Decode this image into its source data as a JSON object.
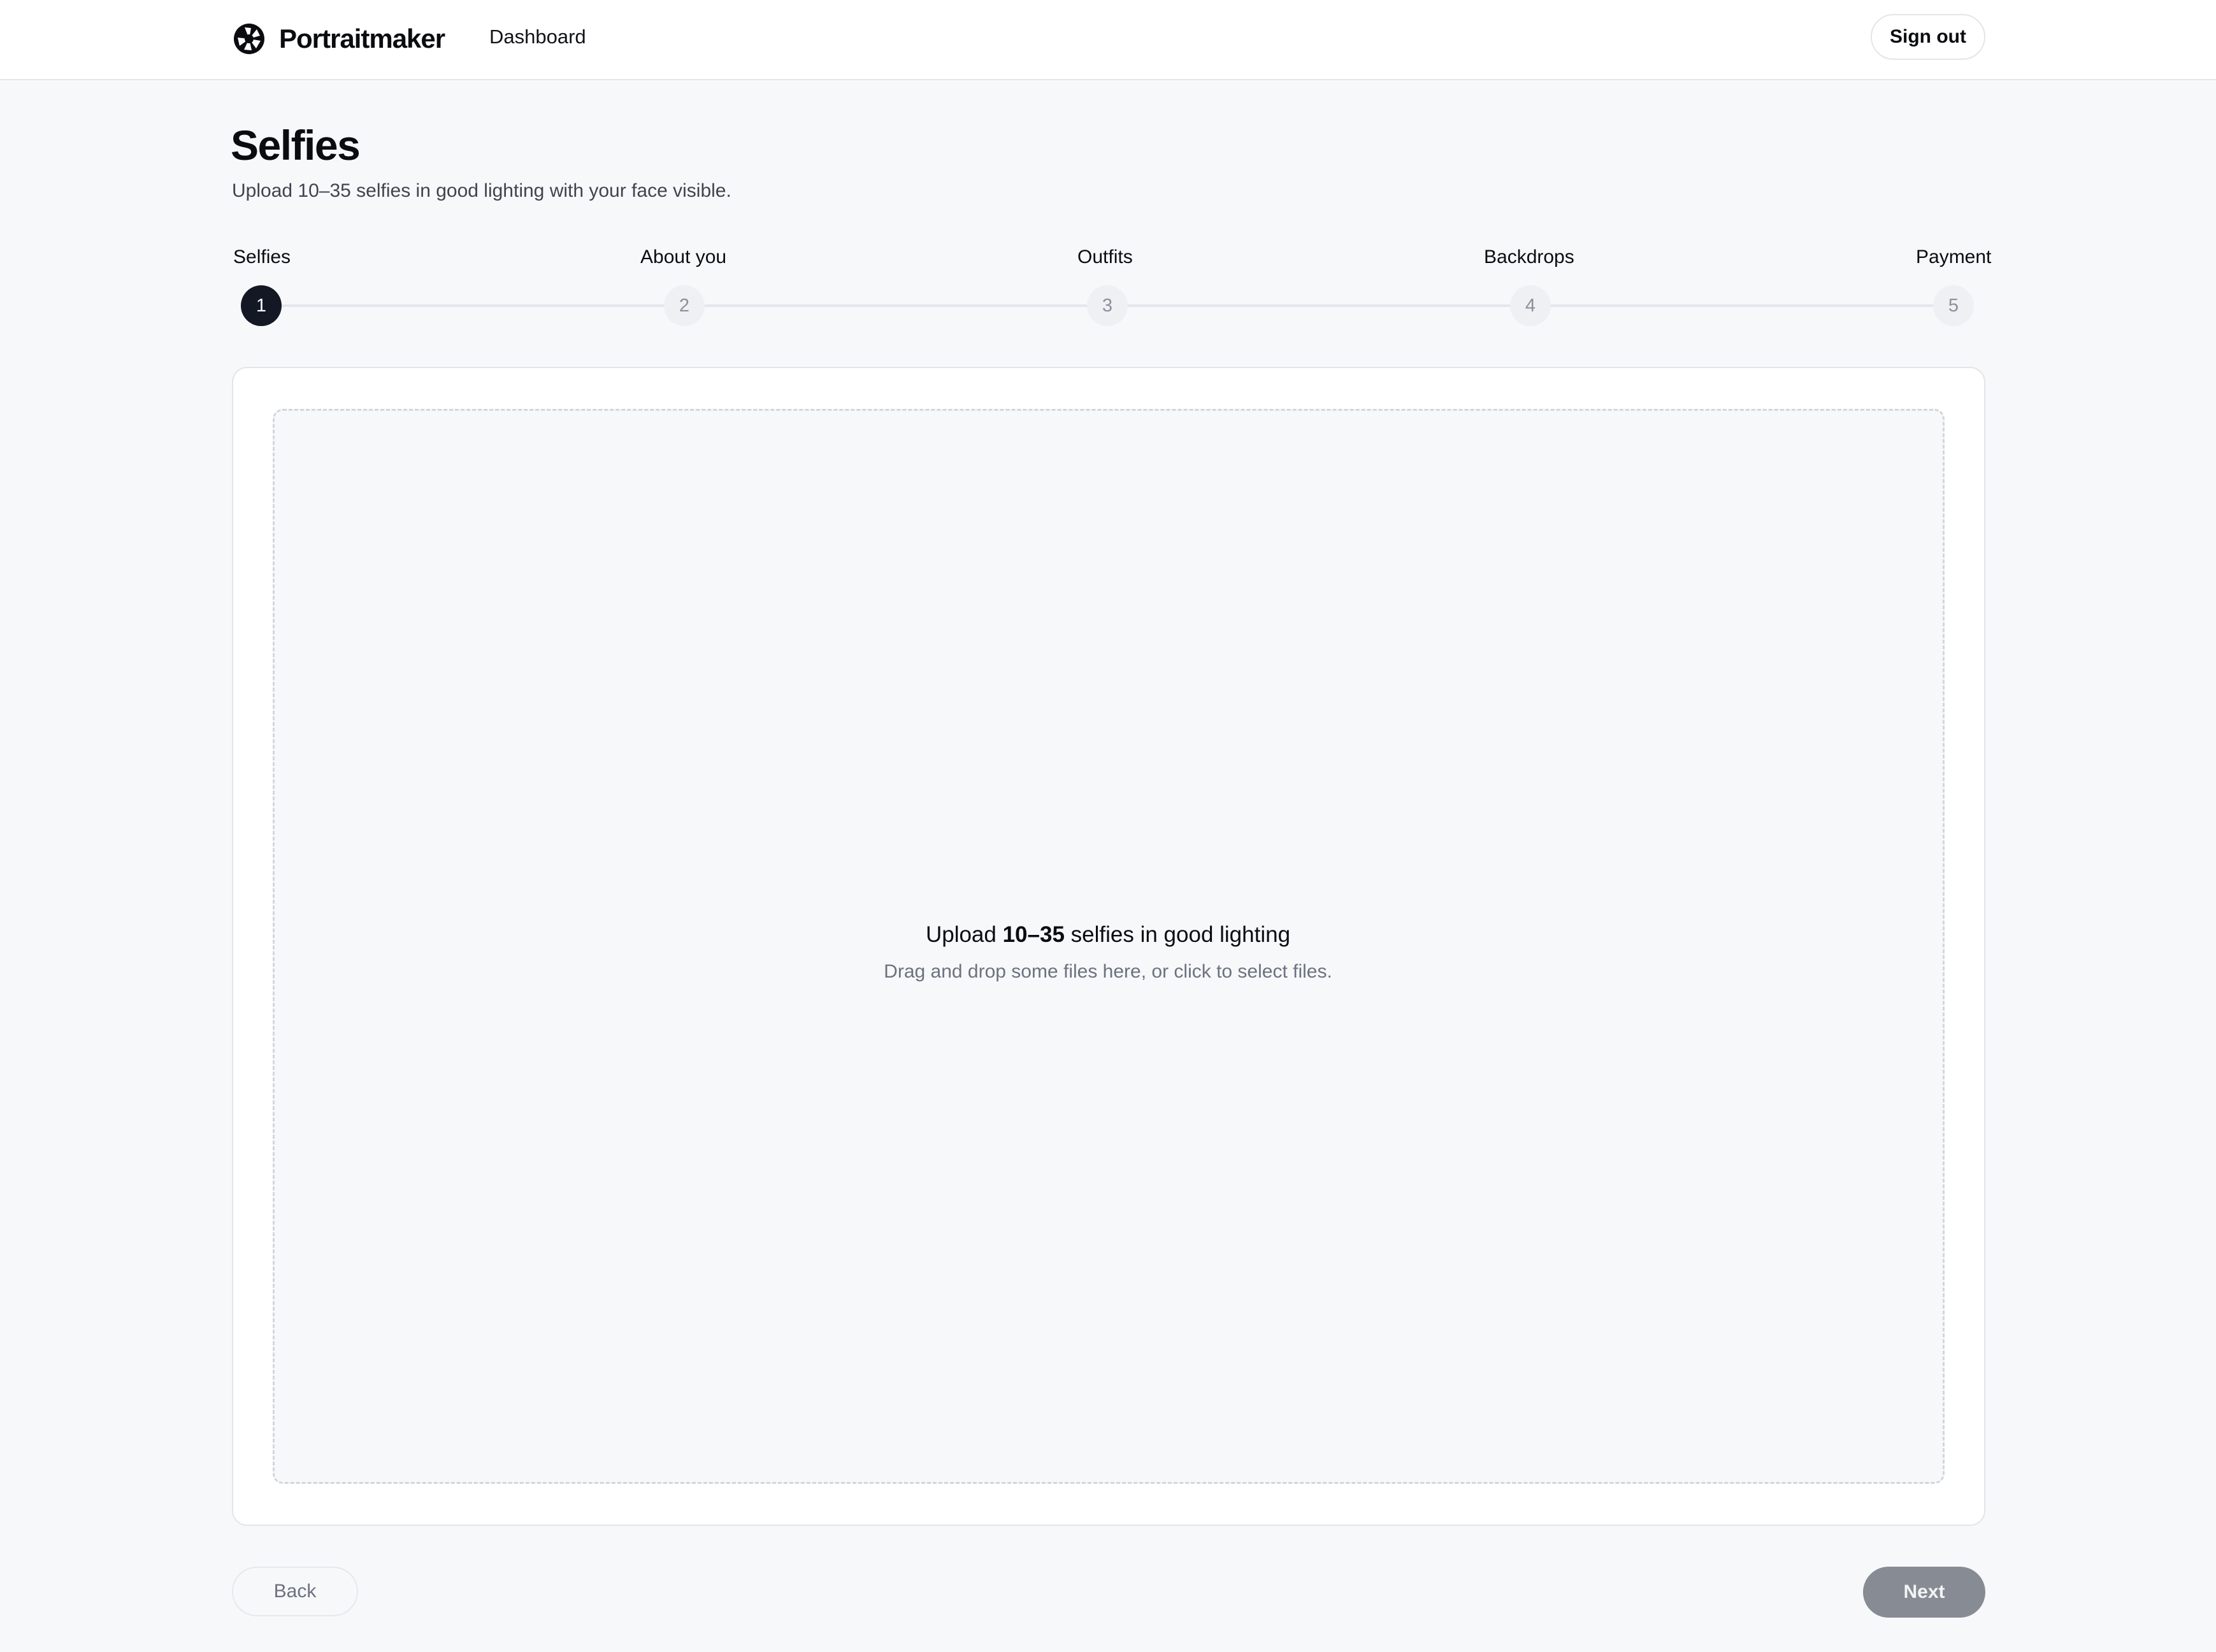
{
  "header": {
    "brand_name": "Portraitmaker",
    "logo_icon": "aperture-icon",
    "nav": [
      {
        "label": "Dashboard"
      }
    ],
    "sign_out_label": "Sign out"
  },
  "page": {
    "title": "Selfies",
    "subtitle": "Upload 10–35 selfies in good lighting with your face visible."
  },
  "stepper": {
    "current_step": 1,
    "steps": [
      {
        "label": "Selfies",
        "number": "1",
        "state": "active"
      },
      {
        "label": "About you",
        "number": "2",
        "state": "inactive"
      },
      {
        "label": "Outfits",
        "number": "3",
        "state": "inactive"
      },
      {
        "label": "Backdrops",
        "number": "4",
        "state": "inactive"
      },
      {
        "label": "Payment",
        "number": "5",
        "state": "inactive"
      }
    ]
  },
  "dropzone": {
    "heading_prefix": "Upload ",
    "heading_bold": "10–35",
    "heading_suffix": " selfies in good lighting",
    "hint": "Drag and drop some files here, or click to select files."
  },
  "footer": {
    "back_label": "Back",
    "next_label": "Next"
  },
  "colors": {
    "page_background": "#f7f8fa",
    "active_step": "#141824",
    "inactive_step": "#eef0f4",
    "next_button_disabled": "#878b93"
  }
}
